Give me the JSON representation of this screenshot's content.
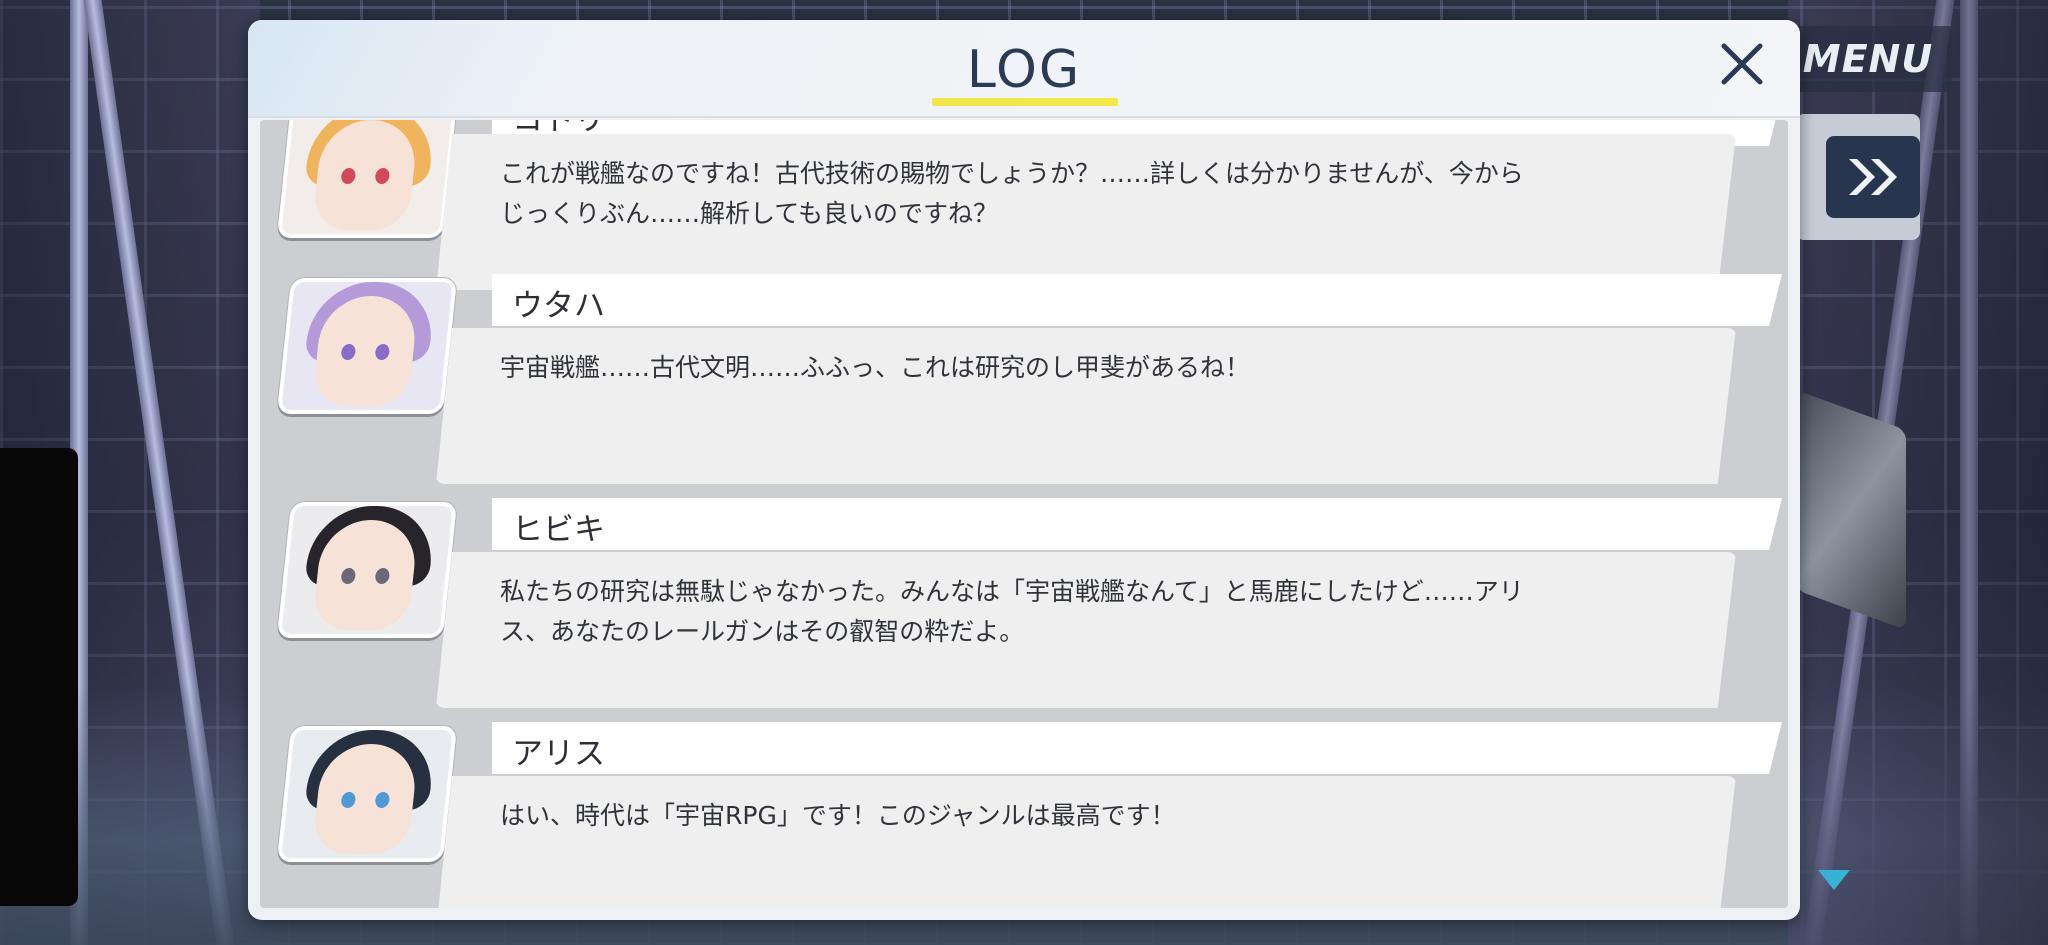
{
  "background": {
    "menu_label": "MENU",
    "fast_forward_icon": "double-chevron-right-icon",
    "next_indicator_icon": "triangle-down-icon"
  },
  "log": {
    "title": "LOG",
    "close_icon": "close-icon",
    "accent_color": "#f3e84a",
    "entries": [
      {
        "name": "コトリ",
        "text": "これが戦艦なのですね！古代技術の賜物でしょうか？……詳しくは分かりませんが、今から\nじっくりぶん……解析しても良いのですね？",
        "portrait": "kotori-portrait"
      },
      {
        "name": "ウタハ",
        "text": "宇宙戦艦……古代文明……ふふっ、これは研究のし甲斐があるね！",
        "portrait": "utaha-portrait"
      },
      {
        "name": "ヒビキ",
        "text": "私たちの研究は無駄じゃなかった。みんなは「宇宙戦艦なんて」と馬鹿にしたけど……アリ\nス、あなたのレールガンはその叡智の粋だよ。",
        "portrait": "hibiki-portrait"
      },
      {
        "name": "アリス",
        "text": "はい、時代は「宇宙RPG」です！このジャンルは最高です！",
        "portrait": "aris-portrait"
      }
    ]
  }
}
